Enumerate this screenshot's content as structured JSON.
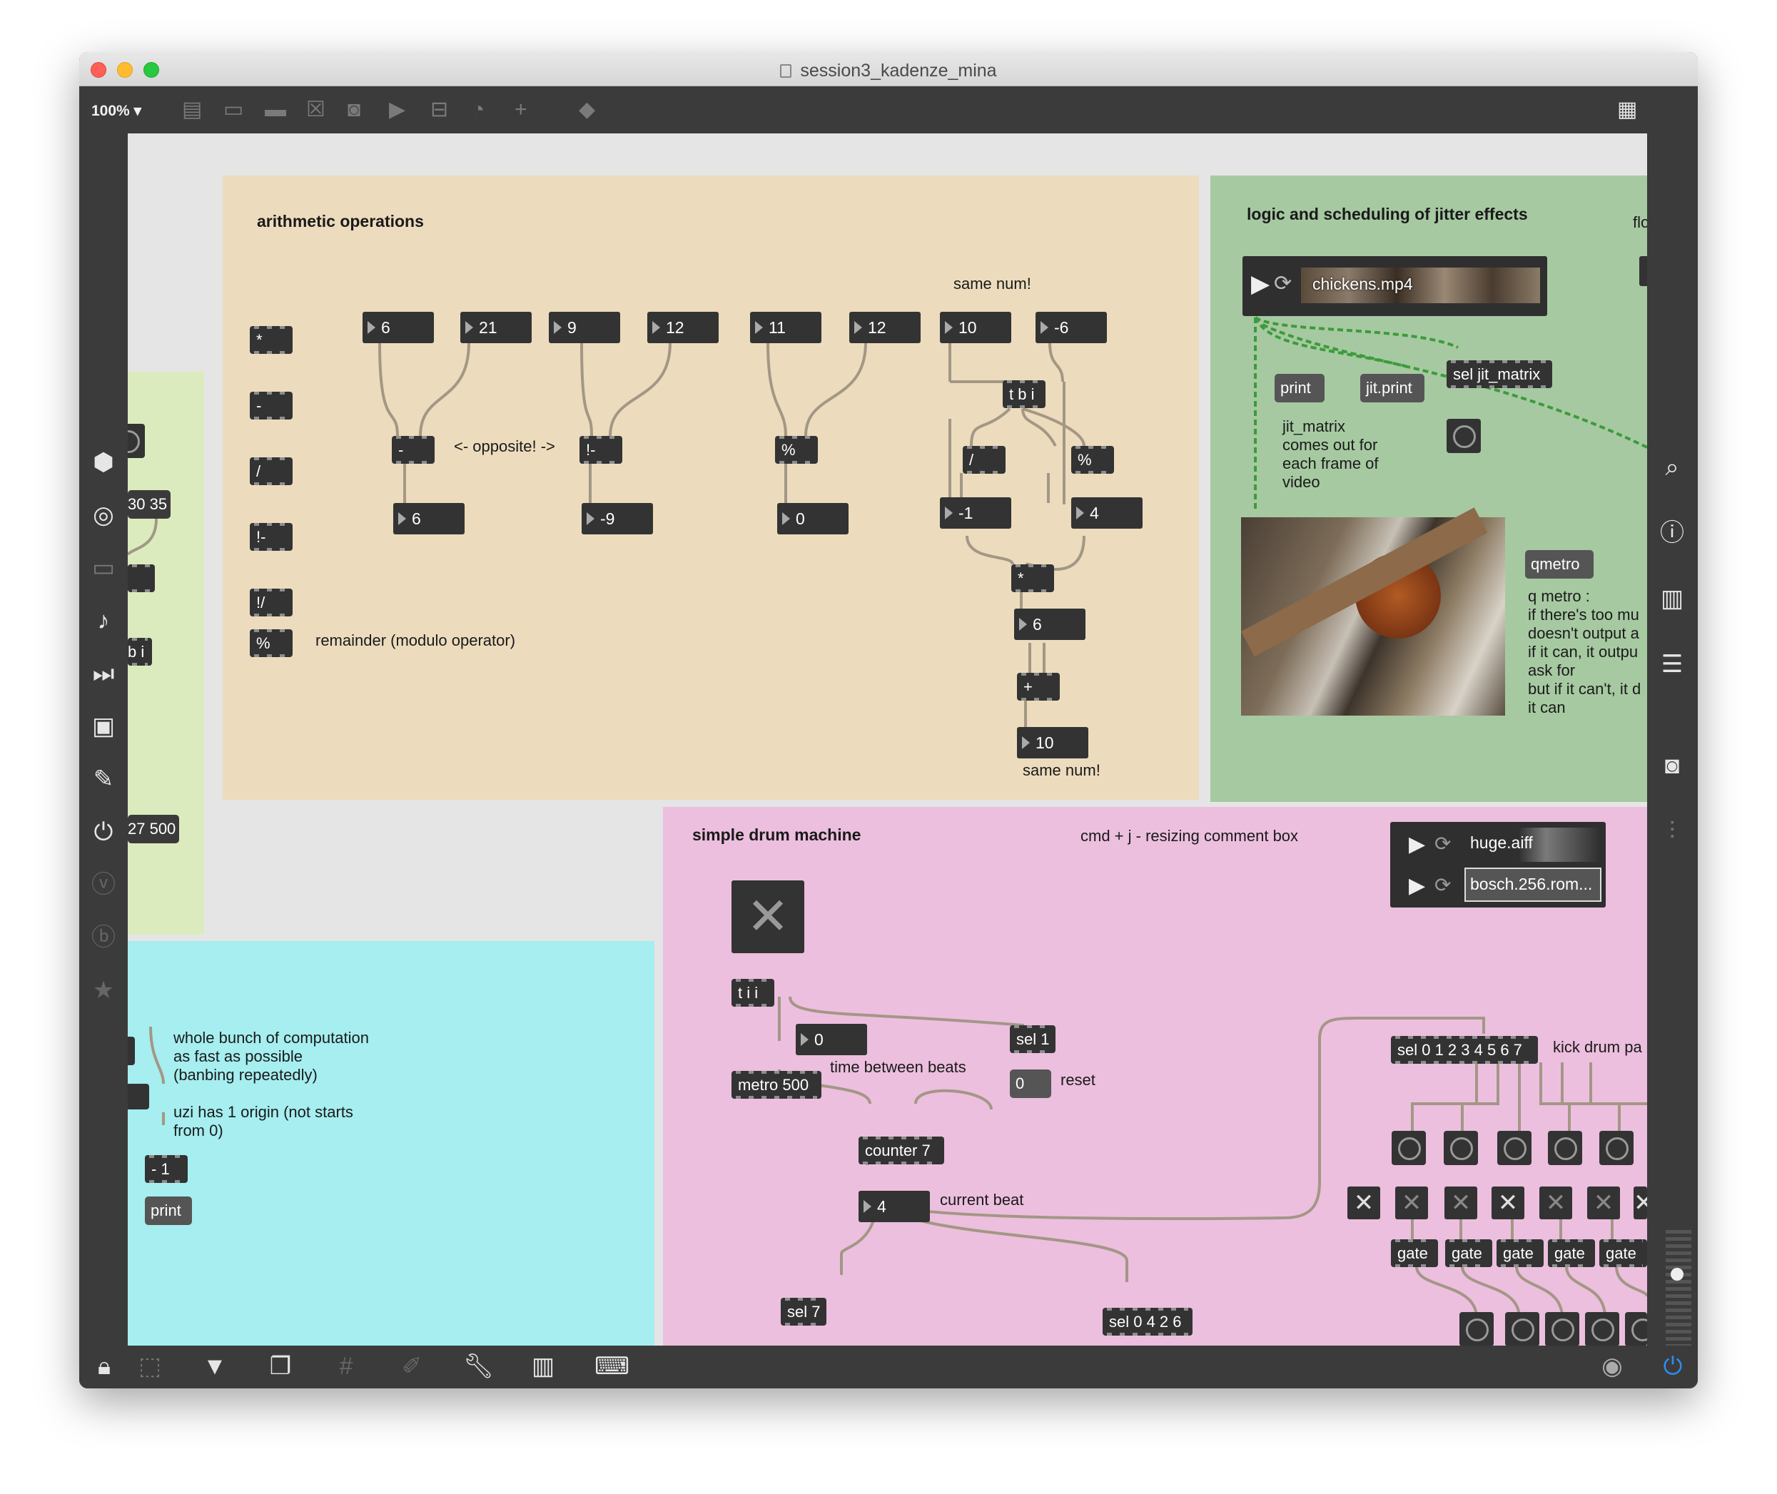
{
  "window": {
    "title": "session3_kadenze_mina",
    "zoom": "100%"
  },
  "toolbar": {
    "icons": [
      "object-box-icon",
      "message-box-icon",
      "comment-icon",
      "button-icon",
      "toggle-icon",
      "number-icon",
      "slider-icon",
      "dial-icon",
      "add-icon",
      "paint-bucket-icon",
      "grid-icon"
    ]
  },
  "left_sidebar": {
    "icons": [
      "cube-icon",
      "target-icon",
      "bench-icon",
      "music-note-icon",
      "media-icon",
      "image-icon",
      "paperclip-icon",
      "plug-icon",
      "vimeo-icon",
      "b-icon",
      "star-icon"
    ]
  },
  "right_sidebar": {
    "icons": [
      "search-icon",
      "info-icon",
      "book-icon",
      "list-icon",
      "camera-icon",
      "mixer-icon",
      "power-icon"
    ]
  },
  "bottom_bar": {
    "icons": [
      "lock-icon",
      "pointer-icon",
      "presentation-icon",
      "windows-icon",
      "grid-icon",
      "pin-icon",
      "wrench-icon",
      "piano-icon",
      "keyboard-icon",
      "play-icon"
    ]
  },
  "arithmetic": {
    "title": "arithmetic operations",
    "ops": [
      "*",
      "-",
      "/",
      "!-",
      "!/",
      "%"
    ],
    "remainder_note": "remainder (modulo operator)",
    "opposite_note": "<- opposite! ->",
    "same_num_top": "same num!",
    "same_num_bottom": "same num!",
    "inputs": [
      "6",
      "21",
      "9",
      "12",
      "11",
      "12",
      "10",
      "-6"
    ],
    "op_minus": "-",
    "op_rminus": "!-",
    "op_mod": "%",
    "results": [
      "6",
      "-9",
      "0"
    ],
    "tbi": "t b i",
    "div": "/",
    "mod2": "%",
    "res_div": "-1",
    "res_mod": "4",
    "mul": "*",
    "res_mul": "6",
    "plus": "+",
    "res_final": "10"
  },
  "logic": {
    "title": "logic and scheduling of jitter effects",
    "partial_title": "flo",
    "movie_file": "chickens.mp4",
    "print": "print",
    "jit_print": "jit.print",
    "sel_jit_matrix": "sel jit_matrix",
    "jit_note": "jit_matrix\ncomes out for\neach frame of\nvideo",
    "qmetro": "qmetro",
    "qmetro_note": "q metro :\nif there's too mu\ndoesn't output a\nif it can, it outpu\nask for\nbut if it can't, it d\nit can"
  },
  "green_left": {
    "num1": "30 35",
    "obj_partial": "b i",
    "num2": "27 500"
  },
  "cyan": {
    "note": "whole bunch of computation\nas fast as possible\n(banbing repeatedly)\n\nuzi has 1 origin (not starts\nfrom 0)",
    "minus1": "- 1",
    "print": "print"
  },
  "drum": {
    "title": "simple drum machine",
    "hint": "cmd + j - resizing comment box",
    "audio_file1": "huge.aiff",
    "audio_file2": "bosch.256.rom...",
    "tii": "t i i",
    "num_zero": "0",
    "sel1": "sel 1",
    "metro": "metro 500",
    "time_note": "time between beats",
    "msg_zero": "0",
    "reset": "reset",
    "counter": "counter 7",
    "beat_num": "4",
    "current_beat": "current beat",
    "sel7": "sel 7",
    "sel_pattern": "sel 0 4 2 6",
    "sel_all": "sel 0 1 2 3 4 5 6 7",
    "kick_note": "kick drum pa",
    "gate": "gate",
    "toggle_states": [
      true,
      false,
      false,
      true,
      false,
      false,
      true
    ]
  },
  "colors": {
    "arith_bg": "#ecdcbd",
    "logic_bg": "#a6c9a1",
    "green_left_bg": "#dcebbe",
    "cyan_bg": "#a6eef0",
    "drum_bg": "#ecbfde",
    "wire": "#a39785",
    "wire_green": "#3c9b3c"
  }
}
